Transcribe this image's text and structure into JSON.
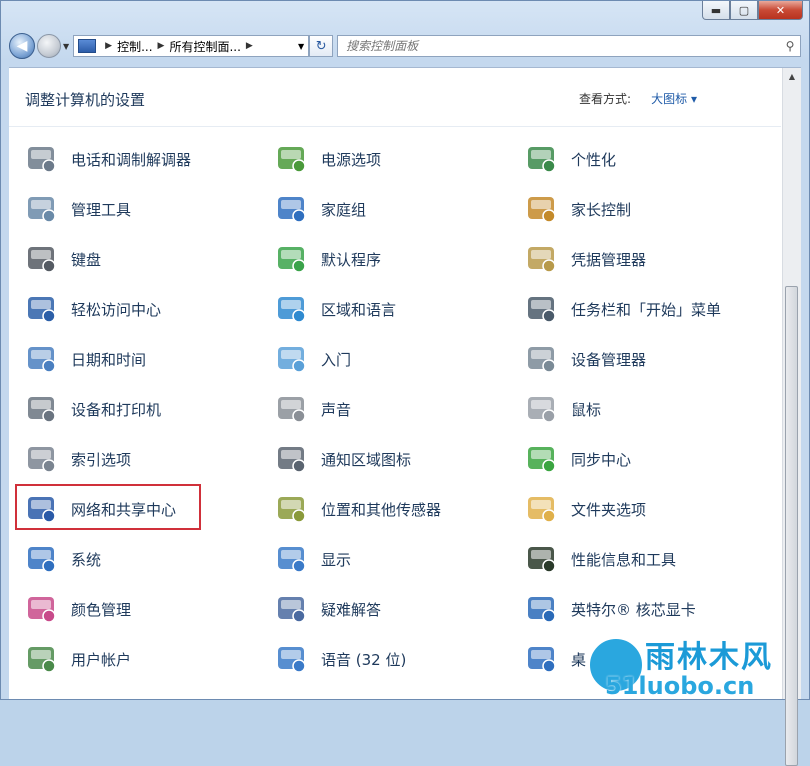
{
  "window": {
    "caption_min": "▬",
    "caption_max": "▢",
    "caption_close": "✕"
  },
  "address": {
    "crumbs": [
      "控制...",
      "所有控制面..."
    ],
    "search_placeholder": "搜索控制面板"
  },
  "header": {
    "title": "调整计算机的设置",
    "view_by_label": "查看方式:",
    "view_by_value": "大图标 ▾"
  },
  "items": [
    [
      {
        "label": "电话和调制解调器",
        "icon": "phone-modem-icon",
        "color": "#6c7a8a"
      },
      {
        "label": "电源选项",
        "icon": "power-options-icon",
        "color": "#4a9a3a"
      },
      {
        "label": "个性化",
        "icon": "personalization-icon",
        "color": "#3a8a4a"
      }
    ],
    [
      {
        "label": "管理工具",
        "icon": "admin-tools-icon",
        "color": "#6a8aa8"
      },
      {
        "label": "家庭组",
        "icon": "homegroup-icon",
        "color": "#2f6fbf"
      },
      {
        "label": "家长控制",
        "icon": "parental-controls-icon",
        "color": "#c48a2a"
      }
    ],
    [
      {
        "label": "键盘",
        "icon": "keyboard-icon",
        "color": "#555b63"
      },
      {
        "label": "默认程序",
        "icon": "default-programs-icon",
        "color": "#3aa34a"
      },
      {
        "label": "凭据管理器",
        "icon": "credential-manager-icon",
        "color": "#b89a4a"
      }
    ],
    [
      {
        "label": "轻松访问中心",
        "icon": "ease-of-access-icon",
        "color": "#2c5fa8"
      },
      {
        "label": "区域和语言",
        "icon": "region-language-icon",
        "color": "#2f8ad0"
      },
      {
        "label": "任务栏和「开始」菜单",
        "icon": "taskbar-start-menu-icon",
        "color": "#4a5a6a"
      }
    ],
    [
      {
        "label": "日期和时间",
        "icon": "date-time-icon",
        "color": "#4a7fc0"
      },
      {
        "label": "入门",
        "icon": "getting-started-icon",
        "color": "#5aa0d8"
      },
      {
        "label": "设备管理器",
        "icon": "device-manager-icon",
        "color": "#7a8a96"
      }
    ],
    [
      {
        "label": "设备和打印机",
        "icon": "devices-printers-icon",
        "color": "#6a7480"
      },
      {
        "label": "声音",
        "icon": "sound-icon",
        "color": "#8a8f96"
      },
      {
        "label": "鼠标",
        "icon": "mouse-icon",
        "color": "#9aa0a8"
      }
    ],
    [
      {
        "label": "索引选项",
        "icon": "indexing-options-icon",
        "color": "#7a8490"
      },
      {
        "label": "通知区域图标",
        "icon": "notification-area-icon",
        "color": "#5a6470"
      },
      {
        "label": "同步中心",
        "icon": "sync-center-icon",
        "color": "#3aa540"
      }
    ],
    [
      {
        "label": "网络和共享中心",
        "icon": "network-sharing-icon",
        "color": "#2a5aa8"
      },
      {
        "label": "位置和其他传感器",
        "icon": "location-sensors-icon",
        "color": "#8a9a3a"
      },
      {
        "label": "文件夹选项",
        "icon": "folder-options-icon",
        "color": "#e0b04a"
      }
    ],
    [
      {
        "label": "系统",
        "icon": "system-icon",
        "color": "#2f6fbf"
      },
      {
        "label": "显示",
        "icon": "display-icon",
        "color": "#3a7ac8"
      },
      {
        "label": "性能信息和工具",
        "icon": "performance-icon",
        "color": "#2a3a2a"
      }
    ],
    [
      {
        "label": "颜色管理",
        "icon": "color-management-icon",
        "color": "#c84a8a"
      },
      {
        "label": "疑难解答",
        "icon": "troubleshooting-icon",
        "color": "#4a6aa0"
      },
      {
        "label": "英特尔® 核芯显卡",
        "icon": "intel-graphics-icon",
        "color": "#2a6ab8"
      }
    ],
    [
      {
        "label": "用户帐户",
        "icon": "user-accounts-icon",
        "color": "#4a8a4a"
      },
      {
        "label": "语音 (32 位)",
        "icon": "speech-icon",
        "color": "#3a7ac8"
      },
      {
        "label": "桌",
        "icon": "desktop-gadgets-icon",
        "color": "#2f6fbf"
      }
    ]
  ],
  "watermark": {
    "title": "雨林木风",
    "url": "51luobo.cn"
  }
}
